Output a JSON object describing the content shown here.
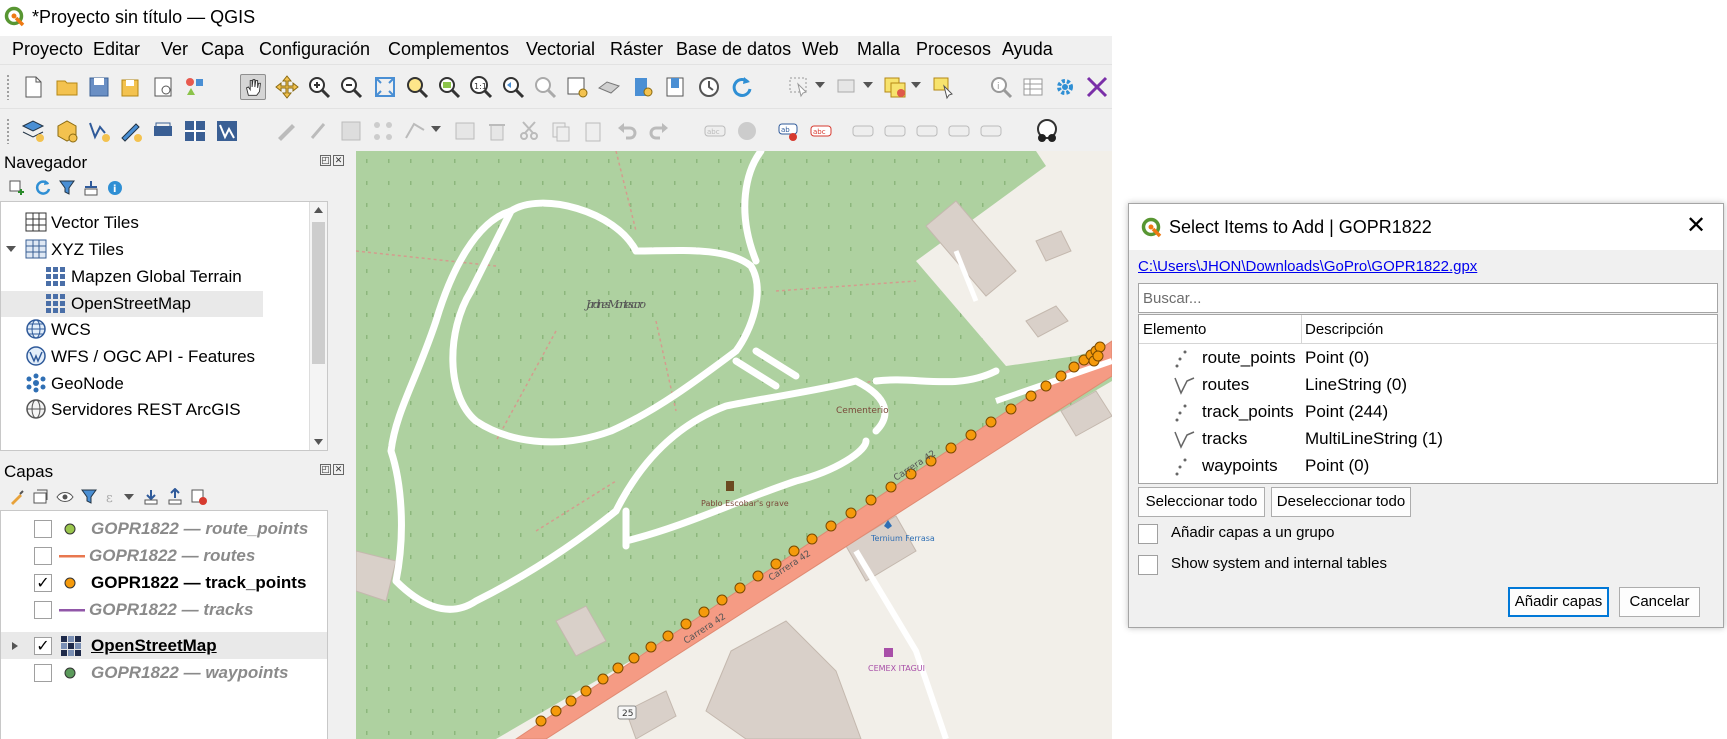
{
  "window": {
    "title": "*Proyecto sin título — QGIS"
  },
  "menubar": {
    "items": [
      "Proyecto",
      "Editar",
      "Ver",
      "Capa",
      "Configuración",
      "Complementos",
      "Vectorial",
      "Ráster",
      "Base de datos",
      "Web",
      "Malla",
      "Procesos",
      "Ayuda"
    ]
  },
  "navigator": {
    "title": "Navegador",
    "items": [
      {
        "label": "Vector Tiles",
        "icon": "grid-icon",
        "indent": 0
      },
      {
        "label": "XYZ Tiles",
        "icon": "grid-icon",
        "indent": 0,
        "expanded": true
      },
      {
        "label": "Mapzen Global Terrain",
        "icon": "tile-grid-icon",
        "indent": 1
      },
      {
        "label": "OpenStreetMap",
        "icon": "tile-grid-icon",
        "indent": 1,
        "selected": true
      },
      {
        "label": "WCS",
        "icon": "globe-icon",
        "indent": 0
      },
      {
        "label": "WFS / OGC API - Features",
        "icon": "wfs-icon",
        "indent": 0
      },
      {
        "label": "GeoNode",
        "icon": "geonode-icon",
        "indent": 0
      },
      {
        "label": "Servidores REST ArcGIS",
        "icon": "arcgis-icon",
        "indent": 0
      }
    ]
  },
  "layers": {
    "title": "Capas",
    "items": [
      {
        "label": "GOPR1822 — route_points",
        "checked": false,
        "symbol": "point",
        "color": "#9ac64d",
        "dim": true
      },
      {
        "label": "GOPR1822 — routes",
        "checked": false,
        "symbol": "line",
        "color": "#e8774f",
        "dim": true
      },
      {
        "label": "GOPR1822 — track_points",
        "checked": true,
        "symbol": "point",
        "color": "#f59a0b",
        "dim": false
      },
      {
        "label": "GOPR1822 — tracks",
        "checked": false,
        "symbol": "line",
        "color": "#9157a8",
        "dim": true
      },
      {
        "label": "OpenStreetMap",
        "checked": true,
        "symbol": "raster",
        "color": "#000000",
        "dim": false,
        "underline": true
      },
      {
        "label": "GOPR1822 — waypoints",
        "checked": false,
        "symbol": "point",
        "color": "#5b9a5b",
        "dim": true
      }
    ]
  },
  "map": {
    "labels": {
      "park": "Jardines Montesacro",
      "cemetery": "Cementerio",
      "grave": "Pablo Escobar's grave",
      "road1": "Carrera 42",
      "road2": "Carrera 42",
      "road3": "Carrera 42",
      "shop": "Ternium Ferrasa",
      "cemex": "CEMEX ITAGUI",
      "shield": "25"
    },
    "colors": {
      "park": "#aed1a0",
      "road": "#f59b84",
      "track": "#f59a0b",
      "background": "#f2efe9"
    }
  },
  "dialog": {
    "title": "Select Items to Add | GOPR1822",
    "path": "C:\\Users\\JHON\\Downloads\\GoPro\\GOPR1822.gpx",
    "search_placeholder": "Buscar...",
    "col_element": "Elemento",
    "col_description": "Descripción",
    "rows": [
      {
        "element": "route_points",
        "description": "Point (0)",
        "icon": "point-layer-icon"
      },
      {
        "element": "routes",
        "description": "LineString (0)",
        "icon": "line-layer-icon"
      },
      {
        "element": "track_points",
        "description": "Point (244)",
        "icon": "point-layer-icon"
      },
      {
        "element": "tracks",
        "description": "MultiLineString (1)",
        "icon": "line-layer-icon"
      },
      {
        "element": "waypoints",
        "description": "Point (0)",
        "icon": "point-layer-icon"
      }
    ],
    "select_all": "Seleccionar todo",
    "deselect_all": "Deseleccionar todo",
    "add_to_group": "Añadir capas a un grupo",
    "show_system": "Show system and internal tables",
    "add_layers": "Añadir capas",
    "cancel": "Cancelar"
  }
}
